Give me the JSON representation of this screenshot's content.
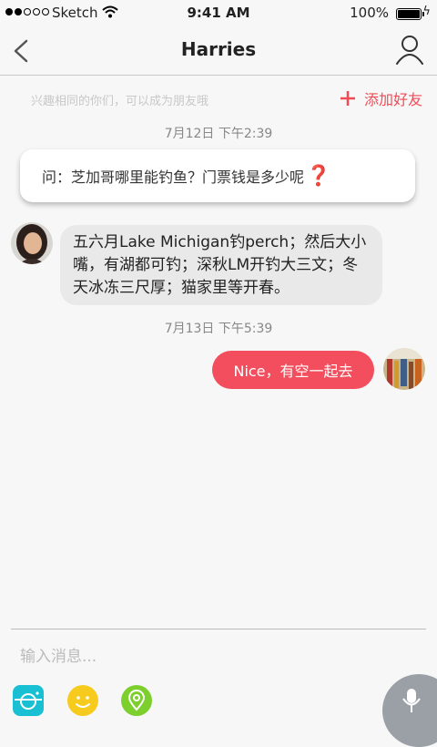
{
  "status_bar": {
    "carrier": "Sketch",
    "time": "9:41 AM",
    "battery": "100%"
  },
  "nav": {
    "title": "Harries"
  },
  "hint": {
    "text": "兴趣相同的你们，可以成为朋友哦",
    "add_friend": "添加好友"
  },
  "messages": {
    "date1": "7月12日   下午2:39",
    "question": "问：芝加哥哪里能钓鱼？门票钱是多少呢",
    "incoming_text": "五六月Lake Michigan钓perch；然后大小嘴，有湖都可钓；深秋LM开钓大三文；冬天冰冻三尺厚；猫家里等开春。",
    "date2": "7月13日   下午5:39",
    "outgoing_text": "Nice，有空一起去"
  },
  "composer": {
    "placeholder": "输入消息..."
  },
  "colors": {
    "accent": "#f24e5d",
    "camera": "#19bfd3",
    "emoji": "#f7cb1e",
    "location": "#7ccf2d",
    "mic": "#9aa0a6"
  }
}
